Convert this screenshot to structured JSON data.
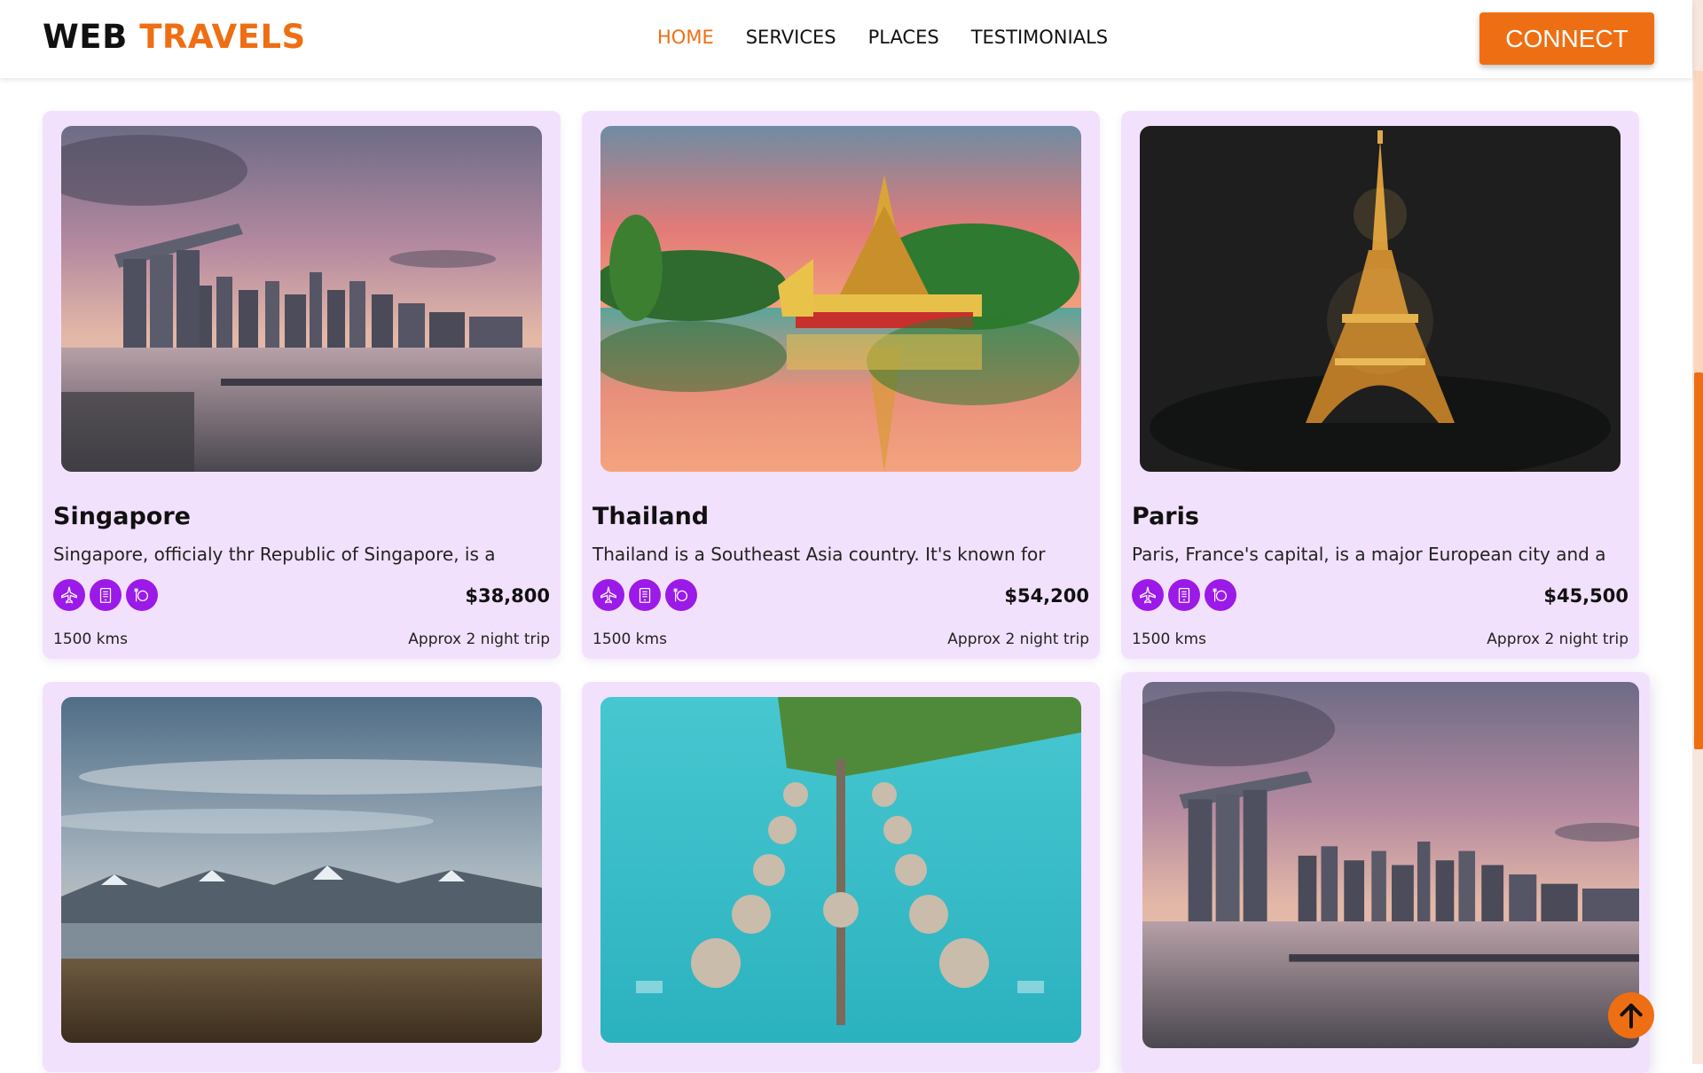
{
  "header": {
    "logo_part1": "WEB",
    "logo_part2": "TRAVELS",
    "nav": [
      "HOME",
      "SERVICES",
      "PLACES",
      "TESTIMONIALS"
    ],
    "active_nav": "HOME",
    "connect_label": "CONNECT"
  },
  "colors": {
    "accent": "#ee6f13",
    "card_bg": "#f2e1fc",
    "icon_bg": "#9b1ae8"
  },
  "cards": [
    {
      "title": "Singapore",
      "desc": "Singapore, officialy thr Republic of Singapore, is a",
      "price": "$38,800",
      "distance": "1500 kms",
      "trip": "Approx 2 night trip",
      "image": "singapore-skyline-sunset"
    },
    {
      "title": "Thailand",
      "desc": "Thailand is a Southeast Asia country. It's known for",
      "price": "$54,200",
      "distance": "1500 kms",
      "trip": "Approx 2 night trip",
      "image": "thailand-golden-temple-boat"
    },
    {
      "title": "Paris",
      "desc": "Paris, France's capital, is a major European city and a",
      "price": "$45,500",
      "distance": "1500 kms",
      "trip": "Approx 2 night trip",
      "image": "eiffel-tower-night"
    },
    {
      "image": "mountain-lake-landscape"
    },
    {
      "image": "overwater-bungalows"
    },
    {
      "image": "singapore-skyline-sunset"
    }
  ],
  "feature_icons": [
    "plane-icon",
    "hotel-icon",
    "food-icon"
  ],
  "back_to_top_icon": "arrow-up-icon"
}
